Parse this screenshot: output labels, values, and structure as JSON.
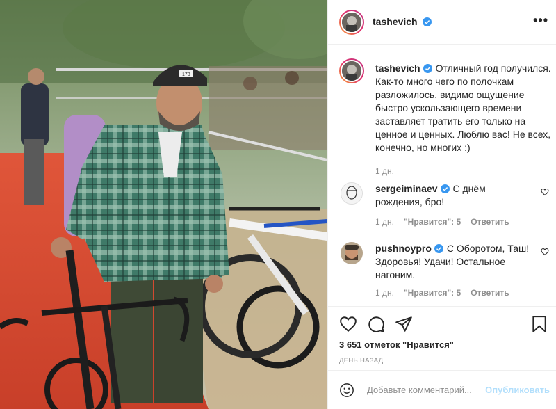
{
  "photo": {
    "alt_subject": "cyclist-with-bike",
    "bib_number": "178"
  },
  "header": {
    "username": "tashevich",
    "more_icon": "more-horizontal-icon",
    "more_glyph": "•••"
  },
  "caption": {
    "username": "tashevich",
    "text": "Отличный год получился. Как-то много чего по полочкам разложилось, видимо ощущение быстро ускользающего времени заставляет тратить его только на ценное и ценных. Люблю вас! Не всех, конечно, но многих :)",
    "time": "1 дн."
  },
  "comments": [
    {
      "username": "sergeiminaev",
      "verified": true,
      "text": "С днём рождения, бро!",
      "time": "1 дн.",
      "likes": "\"Нравится\": 5",
      "reply": "Ответить"
    },
    {
      "username": "pushnoypro",
      "verified": true,
      "text": "С Оборотом, Таш! Здоровья! Удачи! Остальное нагоним.",
      "time": "1 дн.",
      "likes": "\"Нравится\": 5",
      "reply": "Ответить"
    }
  ],
  "actions": {
    "likes_text": "3 651 отметок \"Нравится\"",
    "ago_text": "ДЕНЬ НАЗАД"
  },
  "add_comment": {
    "placeholder": "Добавьте комментарий...",
    "publish_label": "Опубликовать"
  },
  "colors": {
    "verified": "#3897f0",
    "secondary_text": "#8e8e8e",
    "publish_disabled": "#b2dffc",
    "border": "#efefef"
  }
}
